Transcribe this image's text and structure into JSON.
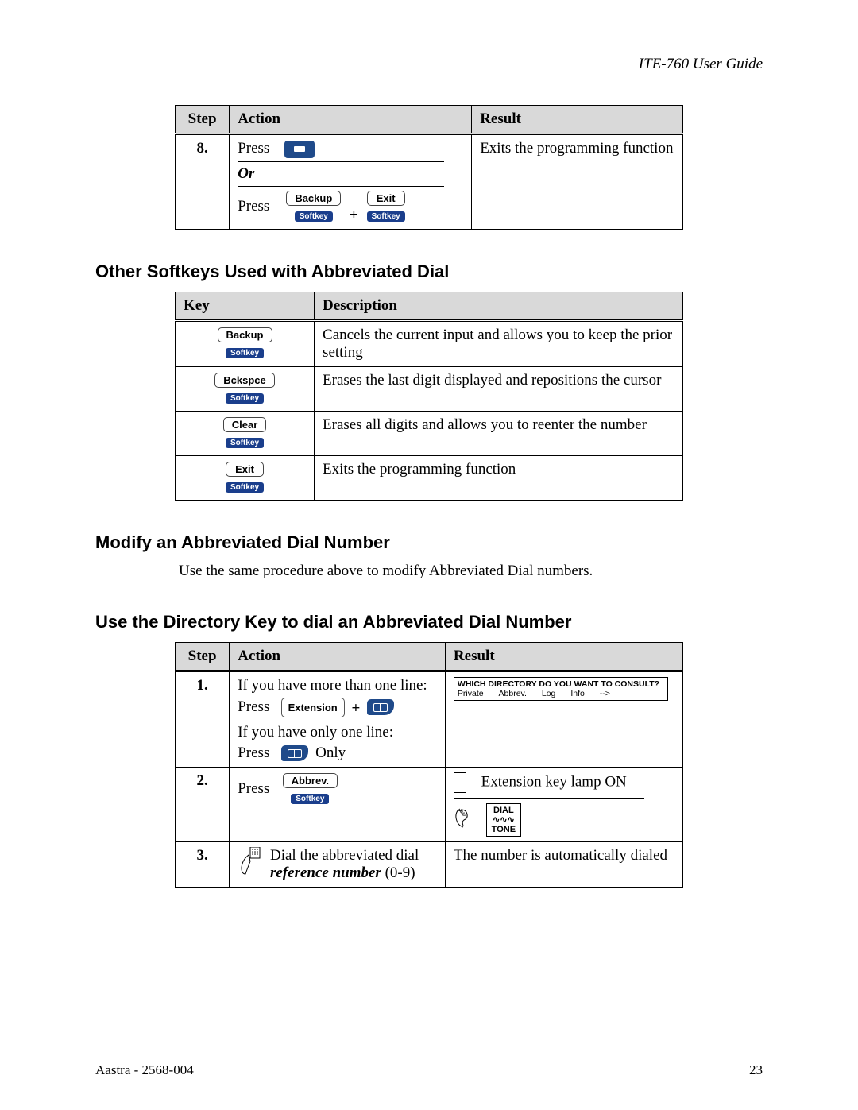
{
  "header": {
    "title": "ITE-760 User Guide"
  },
  "table1": {
    "headers": {
      "step": "Step",
      "action": "Action",
      "result": "Result"
    },
    "step": "8.",
    "press1": "Press",
    "or": "Or",
    "press2": "Press",
    "backup_label": "Backup",
    "exit_label": "Exit",
    "softkey_label": "Softkey",
    "plus": "+",
    "result": "Exits the programming function"
  },
  "section1": {
    "heading": "Other Softkeys Used with Abbreviated Dial"
  },
  "table2": {
    "headers": {
      "key": "Key",
      "description": "Description"
    },
    "softkey_label": "Softkey",
    "rows": [
      {
        "label": "Backup",
        "desc": "Cancels the current input and allows you to keep the prior setting"
      },
      {
        "label": "Bckspce",
        "desc": "Erases the last digit displayed and repositions the cursor"
      },
      {
        "label": "Clear",
        "desc": "Erases all digits and allows you to reenter the number"
      },
      {
        "label": "Exit",
        "desc": "Exits the programming function"
      }
    ]
  },
  "section2": {
    "heading": "Modify an Abbreviated Dial Number",
    "body": "Use the same procedure above to modify Abbreviated Dial numbers."
  },
  "section3": {
    "heading": "Use the Directory Key to dial an Abbreviated Dial Number"
  },
  "table3": {
    "headers": {
      "step": "Step",
      "action": "Action",
      "result": "Result"
    },
    "softkey_label": "Softkey",
    "row1": {
      "step": "1.",
      "line1": "If you have more than one line:",
      "press1": "Press",
      "ext_label": "Extension",
      "plus": "+",
      "line2": "If you have only one line:",
      "press2": "Press",
      "only": "Only",
      "display_title": "WHICH DIRECTORY DO YOU WANT TO CONSULT?",
      "opt1": "Private",
      "opt2": "Abbrev.",
      "opt3": "Log",
      "opt4": "Info",
      "opt5": "-->"
    },
    "row2": {
      "step": "2.",
      "press": "Press",
      "abbrev_label": "Abbrev.",
      "lamp_text": "Extension key lamp ON",
      "dial_l1": "DIAL",
      "dial_sym": "∿∿∿",
      "dial_l2": "TONE"
    },
    "row3": {
      "step": "3.",
      "action_l1": "Dial the abbreviated dial",
      "action_l2_prefix": "reference number",
      "action_l2_suffix": " (0-9)",
      "result": "The number is automatically dialed"
    }
  },
  "footer": {
    "left": "Aastra - 2568-004",
    "right": "23"
  }
}
